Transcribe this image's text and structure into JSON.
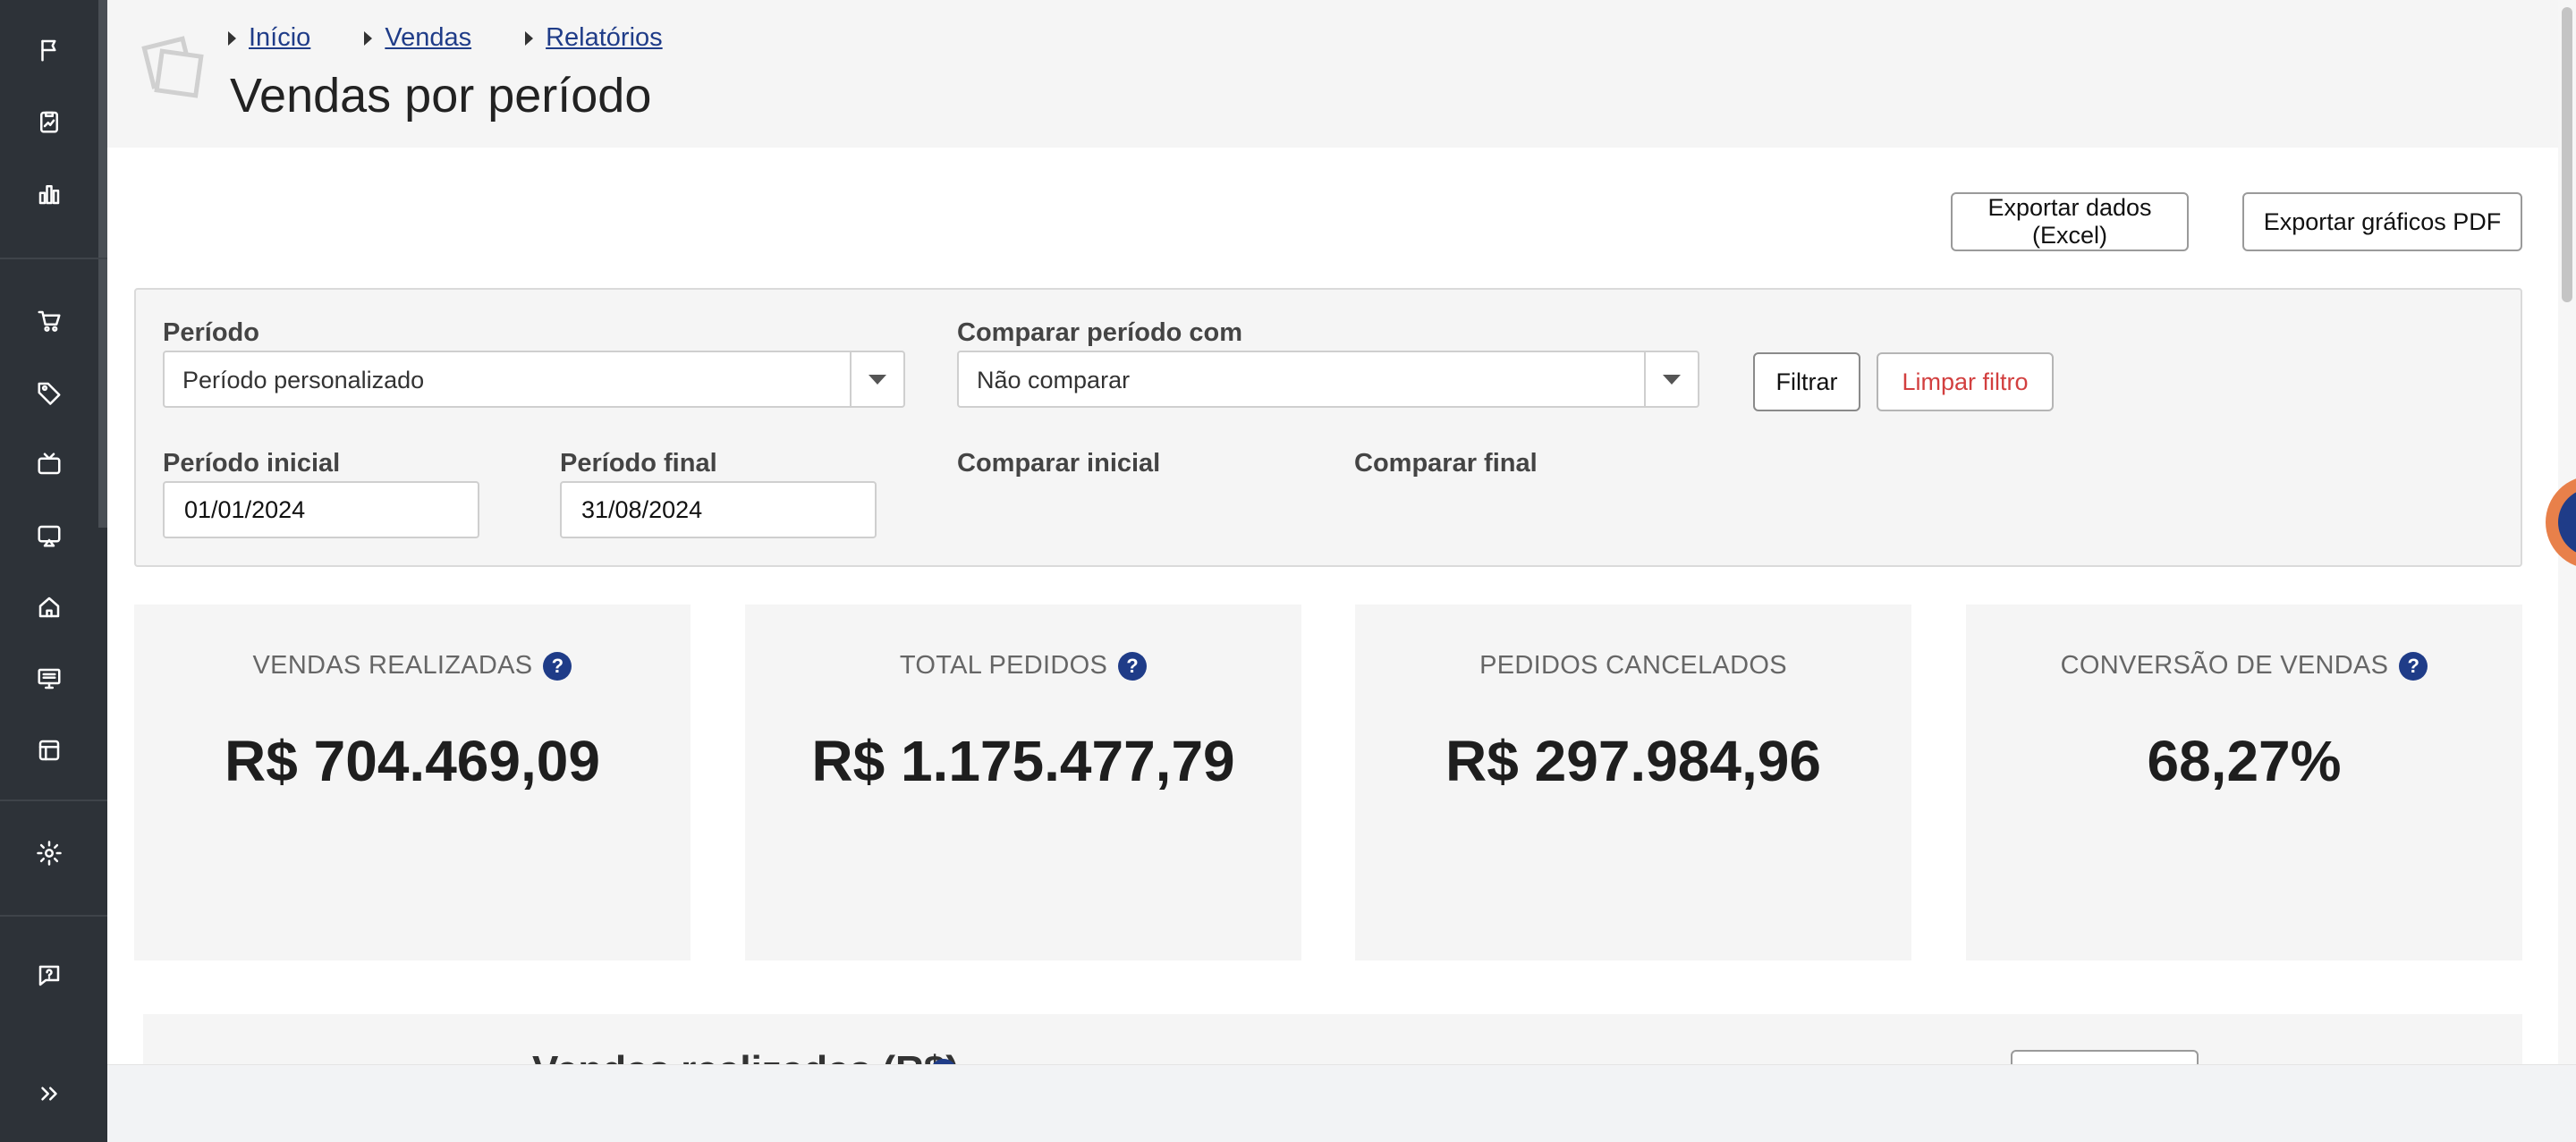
{
  "sidebar": {
    "icons": [
      {
        "name": "flag-icon"
      },
      {
        "name": "clipboard-chart-icon"
      },
      {
        "name": "bar-chart-icon"
      },
      {
        "name": "cart-icon"
      },
      {
        "name": "tag-icon"
      },
      {
        "name": "tv-icon"
      },
      {
        "name": "cast-icon"
      },
      {
        "name": "home-icon"
      },
      {
        "name": "monitor-icon"
      },
      {
        "name": "layout-icon"
      },
      {
        "name": "gear-icon"
      },
      {
        "name": "help-chat-icon"
      },
      {
        "name": "expand-icon"
      }
    ]
  },
  "breadcrumb": {
    "items": [
      "Início",
      "Vendas",
      "Relatórios"
    ]
  },
  "page": {
    "title": "Vendas por período"
  },
  "toolbar": {
    "export_excel_label": "Exportar dados (Excel)",
    "export_pdf_label": "Exportar gráficos PDF"
  },
  "filters": {
    "period_label": "Período",
    "period_value": "Período personalizado",
    "compare_label": "Comparar período com",
    "compare_value": "Não comparar",
    "filter_button": "Filtrar",
    "clear_button": "Limpar filtro",
    "start_label": "Período inicial",
    "start_value": "01/01/2024",
    "end_label": "Período final",
    "end_value": "31/08/2024",
    "compare_start_label": "Comparar inicial",
    "compare_end_label": "Comparar final"
  },
  "kpis": [
    {
      "label": "VENDAS REALIZADAS",
      "value": "R$ 704.469,09",
      "help": "?"
    },
    {
      "label": "TOTAL PEDIDOS",
      "value": "R$ 1.175.477,79",
      "help": "?"
    },
    {
      "label": "PEDIDOS CANCELADOS",
      "value": "R$ 297.984,96"
    },
    {
      "label": "CONVERSÃO DE VENDAS",
      "value": "68,27%",
      "help": "?"
    }
  ],
  "chart_section": {
    "title": "Vendas realizadas (R$)",
    "help": "?"
  },
  "colors": {
    "sidebar_bg": "#2d3238",
    "link": "#1f3c88",
    "help_badge": "#1f3c88",
    "clear_filter_text": "#d23f3f",
    "panel_bg": "#f5f5f5"
  }
}
